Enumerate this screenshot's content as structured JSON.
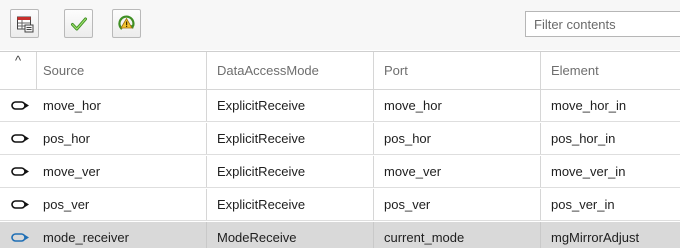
{
  "toolbar": {
    "buttons": [
      {
        "name": "table-view-icon"
      },
      {
        "name": "checkmark-icon"
      },
      {
        "name": "warning-refresh-icon"
      }
    ],
    "filter_placeholder": "Filter contents"
  },
  "table": {
    "sort_indicator": "^",
    "columns": [
      "Source",
      "DataAccessMode",
      "Port",
      "Element"
    ],
    "rows": [
      {
        "source": "move_hor",
        "mode": "ExplicitReceive",
        "port": "move_hor",
        "element": "move_hor_in",
        "selected": false
      },
      {
        "source": "pos_hor",
        "mode": "ExplicitReceive",
        "port": "pos_hor",
        "element": "pos_hor_in",
        "selected": false
      },
      {
        "source": "move_ver",
        "mode": "ExplicitReceive",
        "port": "move_ver",
        "element": "move_ver_in",
        "selected": false
      },
      {
        "source": "pos_ver",
        "mode": "ExplicitReceive",
        "port": "pos_ver",
        "element": "pos_ver_in",
        "selected": false
      },
      {
        "source": "mode_receiver",
        "mode": "ModeReceive",
        "port": "current_mode",
        "element": "mgMirrorAdjust",
        "selected": true
      }
    ]
  },
  "colors": {
    "selected_row": "#d9d9d9",
    "port_icon": "#111111",
    "port_icon_selected": "#1f6fb5"
  }
}
